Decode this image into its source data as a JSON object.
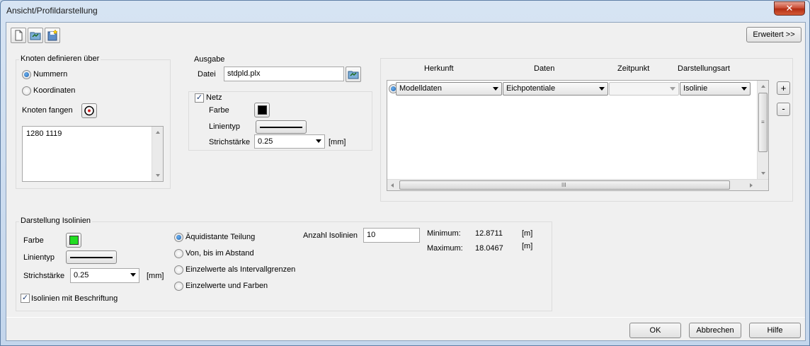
{
  "window": {
    "title": "Ansicht/Profildarstellung",
    "close_glyph": "✕"
  },
  "toolbar": {
    "icons": [
      "new-document-icon",
      "open-folder-icon",
      "save-star-icon"
    ],
    "advanced_button": "Erweitert >>"
  },
  "knoten": {
    "title": "Knoten definieren über",
    "option_nummern": "Nummern",
    "option_koordinaten": "Koordinaten",
    "selected": "Nummern",
    "capture_label": "Knoten fangen",
    "list_text": "1280 1119"
  },
  "ausgabe": {
    "title": "Ausgabe",
    "datei_label": "Datei",
    "datei_value": "stdpld.plx"
  },
  "netz": {
    "checkbox_label": "Netz",
    "checked": true,
    "farbe_label": "Farbe",
    "farbe_color": "#000000",
    "linientyp_label": "Linientyp",
    "strichstaerke_label": "Strichstärke",
    "strichstaerke_value": "0.25",
    "unit": "[mm]"
  },
  "table": {
    "headers": [
      "Herkunft",
      "Daten",
      "Zeitpunkt",
      "Darstellungsart"
    ],
    "rows": [
      {
        "herkunft": "Modelldaten",
        "daten": "Eichpotentiale",
        "zeitpunkt": "",
        "darstellungsart": "Isolinie"
      }
    ],
    "add_button": "+",
    "remove_button": "-",
    "scroll_grip_v": "≡",
    "scroll_grip_h": "III"
  },
  "isolinien": {
    "title": "Darstellung Isolinien",
    "farbe_label": "Farbe",
    "farbe_color": "#22dd22",
    "linientyp_label": "Linientyp",
    "strichstaerke_label": "Strichstärke",
    "strichstaerke_value": "0.25",
    "unit": "[mm]",
    "beschriftung_label": "Isolinien mit Beschriftung",
    "beschriftung_checked": true,
    "options": [
      "Äquidistante Teilung",
      "Von, bis im Abstand",
      "Einzelwerte als Intervallgrenzen",
      "Einzelwerte und Farben"
    ],
    "selected_option": "Äquidistante Teilung",
    "anzahl_label": "Anzahl Isolinien",
    "anzahl_value": "10",
    "minimum_label": "Minimum:",
    "minimum_value": "12.8711",
    "maximum_label": "Maximum:",
    "maximum_value": "18.0467",
    "value_unit": "[m]"
  },
  "footer": {
    "ok": "OK",
    "cancel": "Abbrechen",
    "help": "Hilfe"
  }
}
